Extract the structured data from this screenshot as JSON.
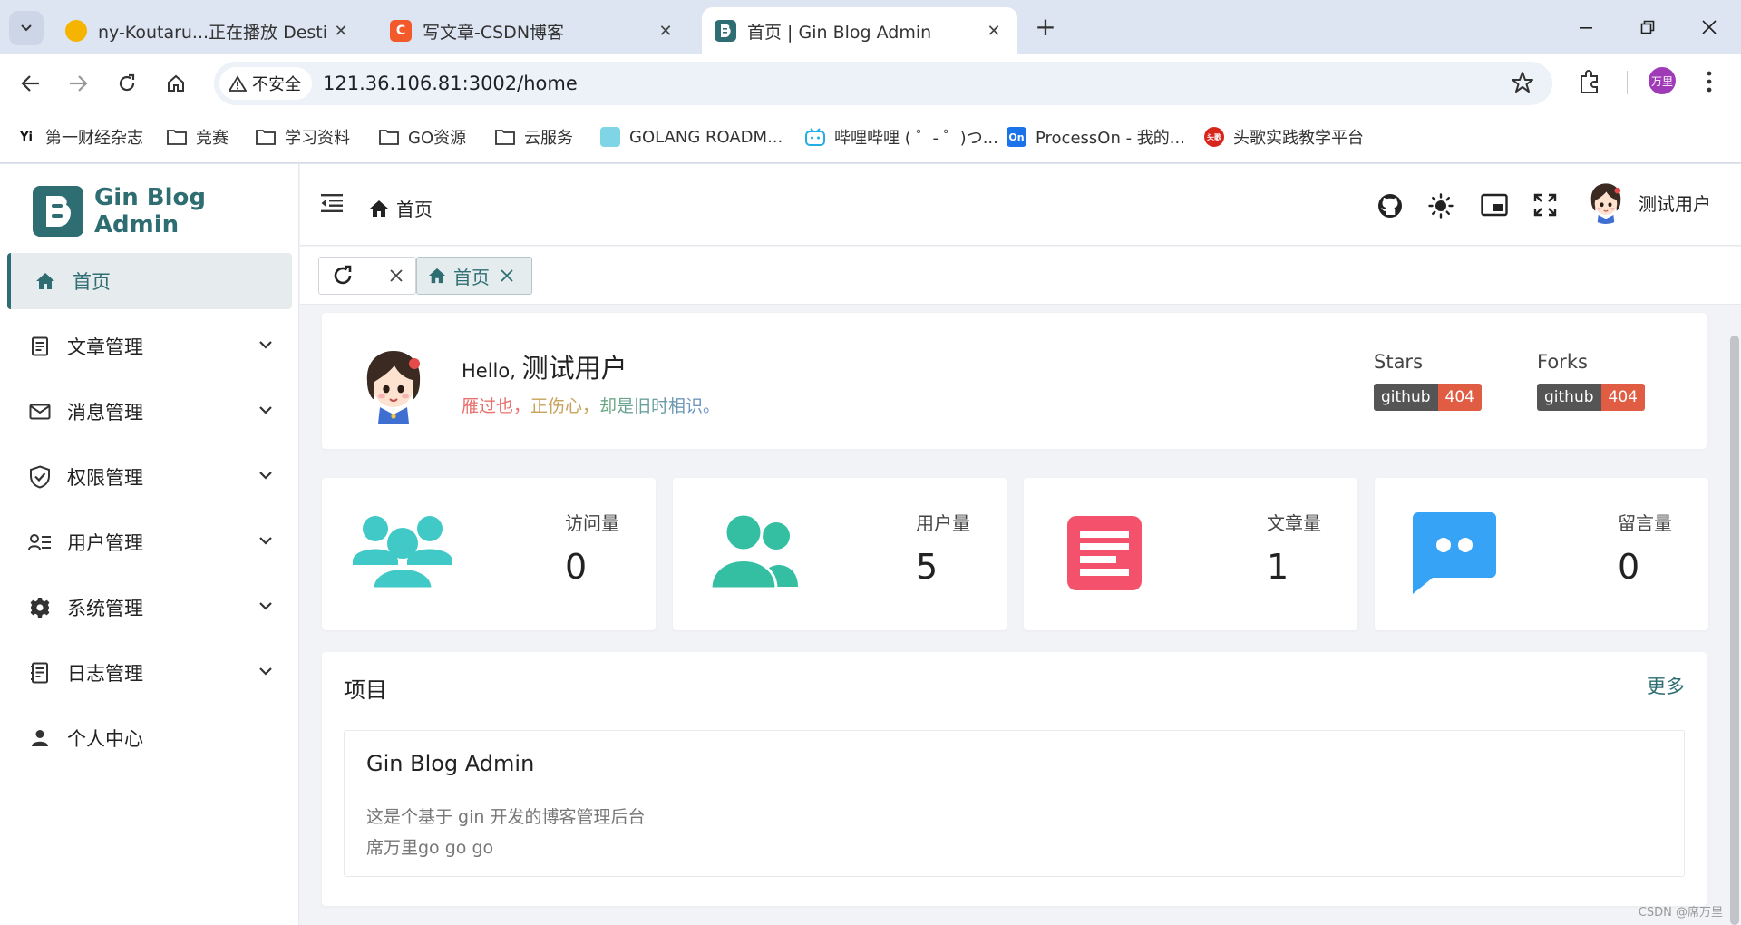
{
  "browser": {
    "tabs": [
      {
        "title": "ny-Koutaru...正在播放 Desti",
        "favicon_color": "#f5b400"
      },
      {
        "title": "写文章-CSDN博客",
        "favicon_color": "#f25a2c",
        "favicon_text": "C"
      },
      {
        "title": "首页 | Gin Blog Admin",
        "favicon_color": "#2e6d72",
        "active": true
      }
    ],
    "security_label": "不安全",
    "url": "121.36.106.81:3002/home",
    "profile_initials": "万里",
    "bookmarks": [
      {
        "label": "第一财经杂志",
        "icon": "yi-logo",
        "icon_text": "Yi"
      },
      {
        "label": "竞赛",
        "icon": "folder-icon"
      },
      {
        "label": "学习资料",
        "icon": "folder-icon"
      },
      {
        "label": "GO资源",
        "icon": "folder-icon"
      },
      {
        "label": "云服务",
        "icon": "folder-icon"
      },
      {
        "label": "GOLANG ROADM...",
        "icon": "gopher-icon"
      },
      {
        "label": "哔哩哔哩 ( ゜- ゜)つ...",
        "icon": "bilibili-icon"
      },
      {
        "label": "ProcessOn - 我的...",
        "icon": "processon-icon",
        "icon_text": "On"
      },
      {
        "label": "头歌实践教学平台",
        "icon": "touge-icon",
        "icon_text": "头歌"
      }
    ]
  },
  "app": {
    "brand": "Gin Blog Admin",
    "accent": "#2e6d72",
    "menu": [
      {
        "label": "首页",
        "icon": "home-icon",
        "active": true
      },
      {
        "label": "文章管理",
        "icon": "article-icon",
        "expandable": true
      },
      {
        "label": "消息管理",
        "icon": "mail-icon",
        "expandable": true
      },
      {
        "label": "权限管理",
        "icon": "shield-icon",
        "expandable": true
      },
      {
        "label": "用户管理",
        "icon": "user-list-icon",
        "expandable": true
      },
      {
        "label": "系统管理",
        "icon": "gear-icon",
        "expandable": true
      },
      {
        "label": "日志管理",
        "icon": "log-icon",
        "expandable": true
      },
      {
        "label": "个人中心",
        "icon": "person-icon"
      }
    ],
    "header": {
      "breadcrumb": "首页",
      "username": "测试用户"
    },
    "tags": [
      {
        "label": "首页",
        "icon": "home-icon"
      }
    ],
    "welcome": {
      "hello": "Hello,",
      "username": "测试用户",
      "motto_parts": [
        "雁过也，",
        "正伤心，",
        "却是旧时相识。"
      ],
      "motto_colors": [
        "#e8706c",
        "#c7a25a",
        "#67a87d",
        "#6e8fd0"
      ],
      "stats": [
        {
          "label": "Stars",
          "badge_left": "github",
          "badge_right": "404"
        },
        {
          "label": "Forks",
          "badge_left": "github",
          "badge_right": "404"
        }
      ]
    },
    "cards": [
      {
        "label": "访问量",
        "value": "0",
        "icon": "visitors-icon",
        "color": "#40c9c6"
      },
      {
        "label": "用户量",
        "value": "5",
        "icon": "users-icon",
        "color": "#34bfa3"
      },
      {
        "label": "文章量",
        "value": "1",
        "icon": "article-icon",
        "color": "#f4516c"
      },
      {
        "label": "留言量",
        "value": "0",
        "icon": "message-icon",
        "color": "#36a3f7"
      }
    ],
    "projects": {
      "title": "项目",
      "more": "更多",
      "items": [
        {
          "name": "Gin Blog Admin",
          "desc": "这是个基于 gin 开发的博客管理后台",
          "author": "席万里go go go"
        }
      ]
    },
    "watermark": "CSDN @席万里"
  }
}
